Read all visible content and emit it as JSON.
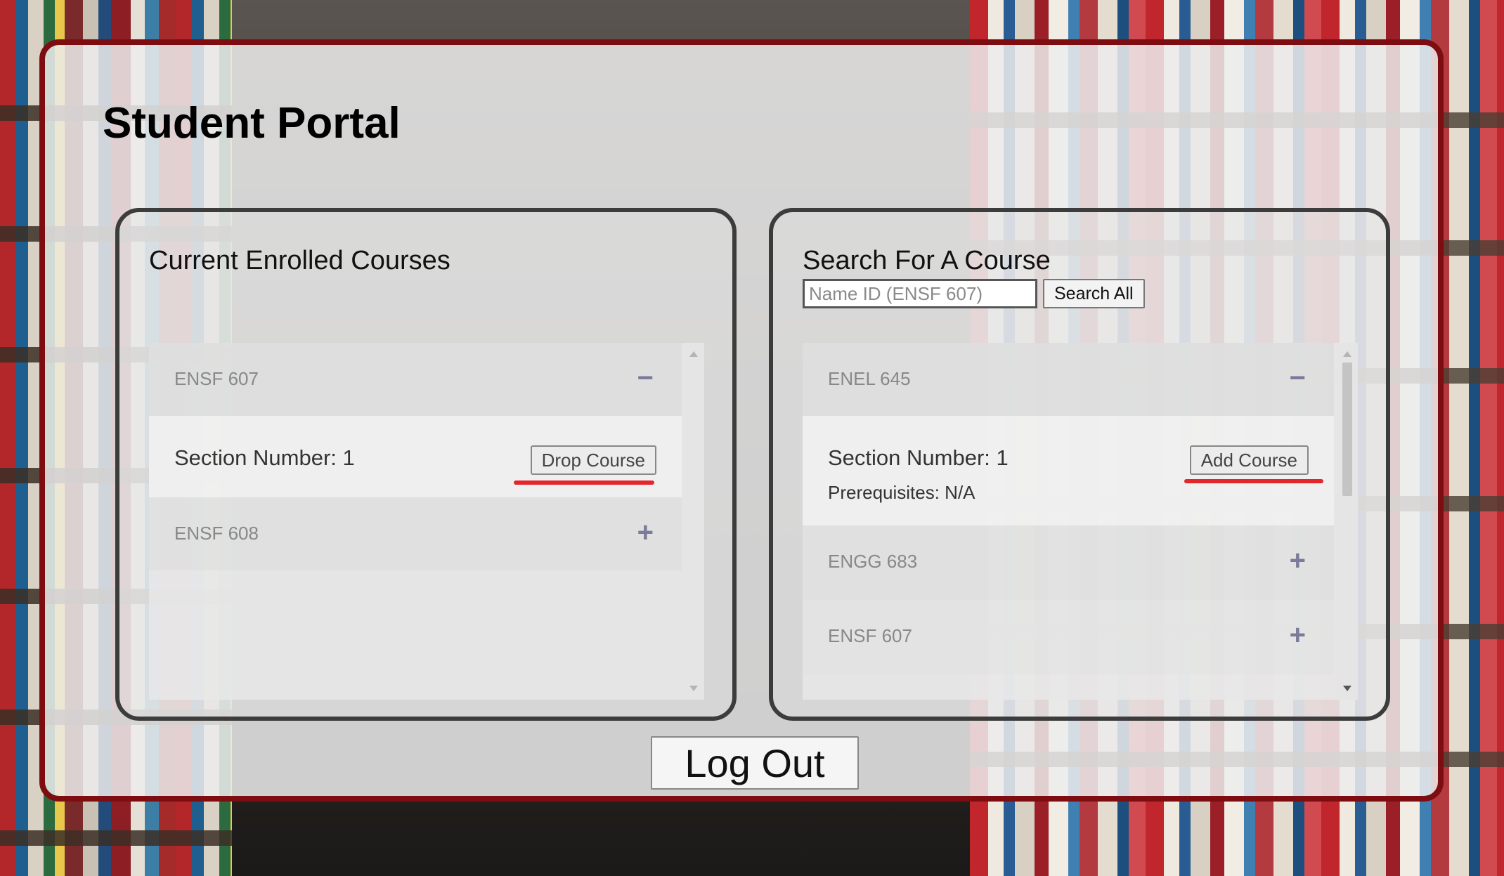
{
  "page": {
    "title": "Student Portal"
  },
  "enrolled": {
    "heading": "Current Enrolled Courses",
    "courses": [
      {
        "code": "ENSF 607",
        "expanded": true,
        "toggle_icon": "minus-icon",
        "section": "Section Number: 1",
        "action": "Drop Course"
      },
      {
        "code": "ENSF 608",
        "expanded": false,
        "toggle_icon": "plus-icon"
      }
    ]
  },
  "search": {
    "heading": "Search For A Course",
    "placeholder": "Name ID (ENSF 607)",
    "value": "",
    "button": "Search All",
    "results": [
      {
        "code": "ENEL 645",
        "expanded": true,
        "toggle_icon": "minus-icon",
        "section": "Section Number: 1",
        "prerequisites": "Prerequisites: N/A",
        "action": "Add Course"
      },
      {
        "code": "ENGG 683",
        "expanded": false,
        "toggle_icon": "plus-icon"
      },
      {
        "code": "ENSF 607",
        "expanded": false,
        "toggle_icon": "plus-icon"
      }
    ]
  },
  "logout": {
    "label": "Log Out"
  },
  "colors": {
    "frame_border": "#7d0d10",
    "highlight_underline": "#e2262b",
    "toggle_icon": "#7a7a9a"
  }
}
